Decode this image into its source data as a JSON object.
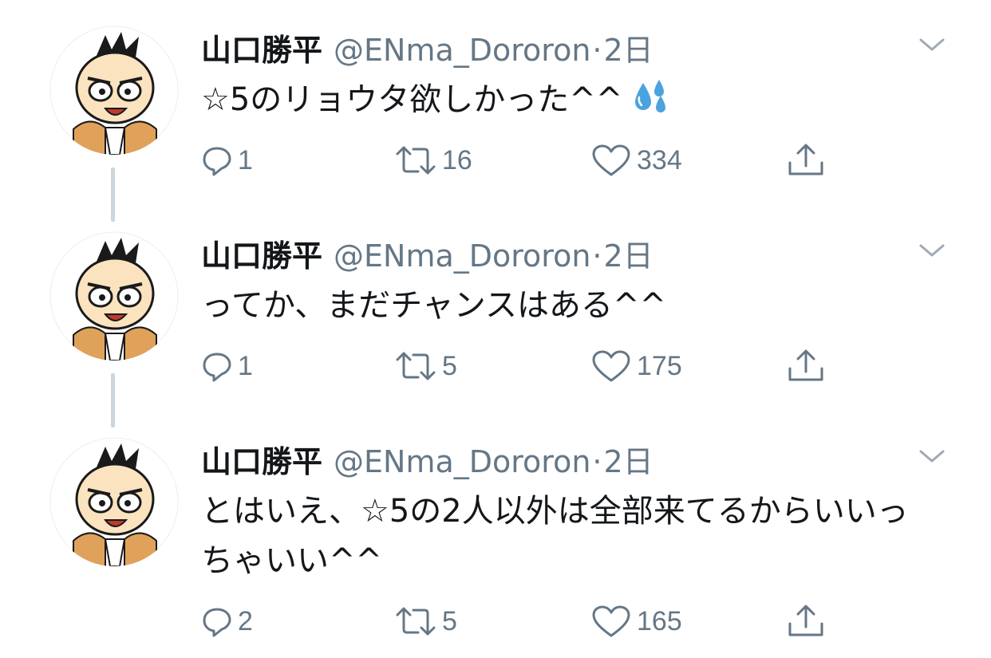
{
  "colors": {
    "text": "#14171a",
    "muted": "#657786",
    "thread_line": "#ccd6dd",
    "icon": "#657786"
  },
  "tweets": [
    {
      "name": "山口勝平",
      "handle": "@ENma_Dororon",
      "separator": "·",
      "time": "2日",
      "text": "☆5のリョウタ欲しかった^^",
      "emoji": "sweat-droplets-icon",
      "replies": "1",
      "retweets": "16",
      "likes": "334"
    },
    {
      "name": "山口勝平",
      "handle": "@ENma_Dororon",
      "separator": "·",
      "time": "2日",
      "text": "ってか、まだチャンスはある^^",
      "replies": "1",
      "retweets": "5",
      "likes": "175"
    },
    {
      "name": "山口勝平",
      "handle": "@ENma_Dororon",
      "separator": "·",
      "time": "2日",
      "text": "とはいえ、☆5の2人以外は全部来てるからいいっちゃいい^^",
      "replies": "2",
      "retweets": "5",
      "likes": "165"
    }
  ]
}
